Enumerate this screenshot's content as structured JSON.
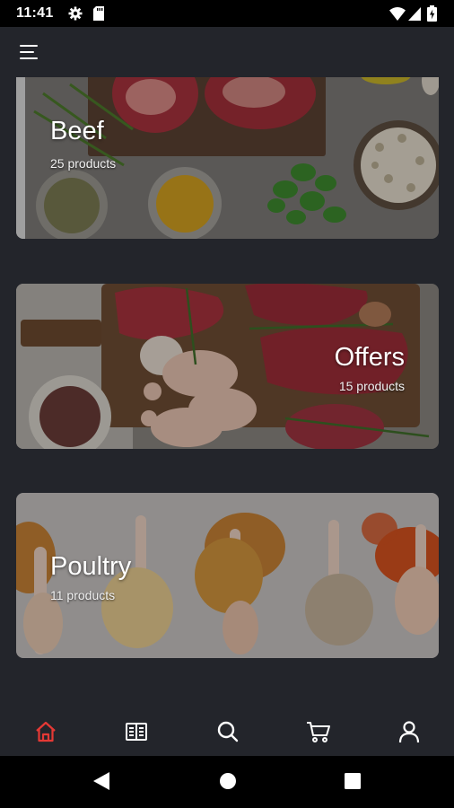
{
  "status_bar": {
    "time": "11:41",
    "icons": [
      "gear-icon",
      "sd-card-icon",
      "wifi-icon",
      "signal-icon",
      "battery-icon"
    ]
  },
  "app_bar": {
    "menu_icon": "hamburger-menu-icon"
  },
  "categories": [
    {
      "title": "Beef",
      "count": "25 products"
    },
    {
      "title": "Offers",
      "count": "15 products"
    },
    {
      "title": "Poultry",
      "count": "11 products"
    }
  ],
  "bottom_nav": {
    "items": [
      "home-icon",
      "catalog-book-icon",
      "search-icon",
      "cart-icon",
      "profile-icon"
    ],
    "active": "home-icon"
  },
  "colors": {
    "background": "#23252b",
    "accent": "#e53935",
    "text": "#ffffff"
  }
}
